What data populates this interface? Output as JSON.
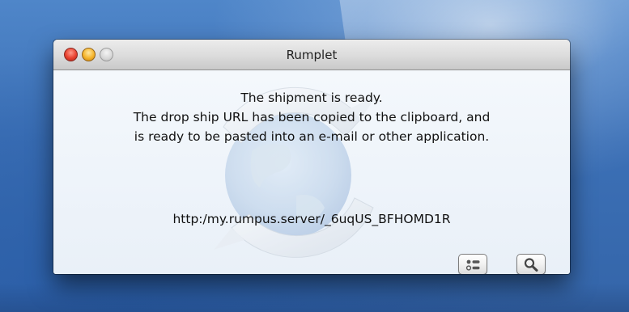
{
  "window": {
    "title": "Rumplet"
  },
  "message": {
    "line1": "The shipment is ready.",
    "line2": "The drop ship URL has been copied to the clipboard, and",
    "line3": "is ready to be pasted into an e-mail or other application."
  },
  "url": "http:/my.rumpus.server/_6uqUS_BFHOMD1R",
  "buttons": {
    "list_icon": "list-icon",
    "search_icon": "magnifier-icon"
  },
  "colors": {
    "close": "#e8402e",
    "minimize": "#f5b42a",
    "zoom": "#d6d6d6"
  }
}
